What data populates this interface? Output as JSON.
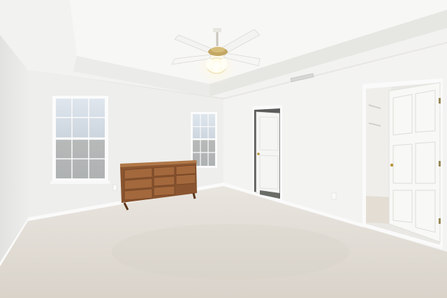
{
  "scene": {
    "kind": "empty carpeted bedroom interior",
    "colors": {
      "wall_left": "#ebebe9",
      "wall_back": "#f1f1ef",
      "wall_right": "#f4f4f2",
      "ceiling": "#f6f6f4",
      "tray": "#eeeeec",
      "carpet": "#e2ddd6",
      "trim": "#fafafa",
      "door": "#f7f7f5",
      "window_sky": "#c9d6e2",
      "dresser": "#9a6238",
      "dresser_dark": "#6f4224",
      "light_glow": "#fff3d0"
    },
    "windows": 2,
    "doors": 2,
    "dresser_drawers": 8
  }
}
